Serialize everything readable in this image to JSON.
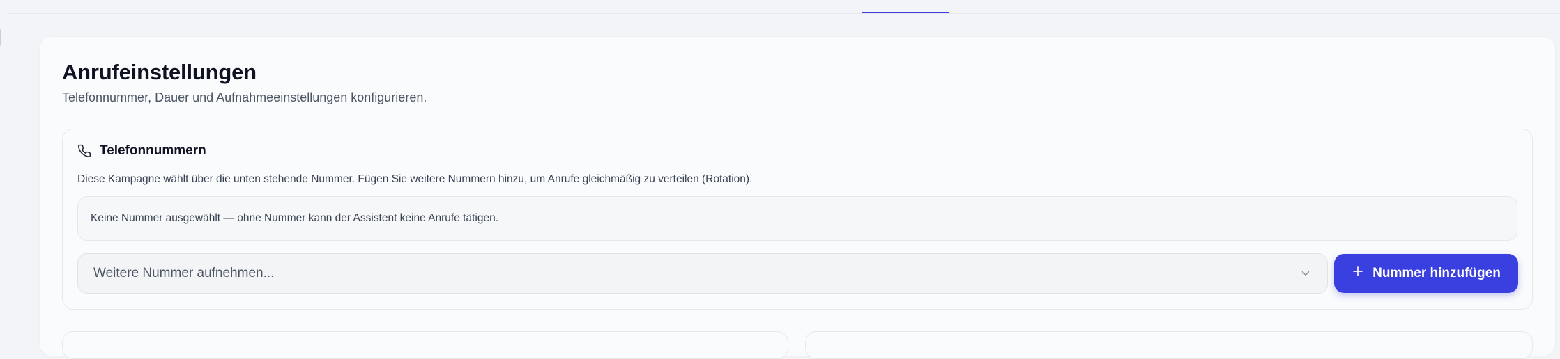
{
  "page": {
    "title": "Anrufeinstellungen",
    "subtitle": "Telefonnummer, Dauer und Aufnahmeeinstellungen konfigurieren."
  },
  "phone_section": {
    "title": "Telefonnummern",
    "icon": "phone-icon",
    "description": "Diese Kampagne wählt über die unten stehende Nummer. Fügen Sie weitere Nummern hinzu, um Anrufe gleichmäßig zu verteilen (Rotation).",
    "notice": "Keine Nummer ausgewählt — ohne Nummer kann der Assistent keine Anrufe tätigen.",
    "select": {
      "placeholder": "Weitere Nummer aufnehmen...",
      "icon": "chevron-down-icon"
    },
    "add_button": {
      "label": "Nummer hinzufügen",
      "icon": "plus-icon"
    }
  },
  "colors": {
    "accent": "#3a3fe0",
    "background": "#f3f4f7",
    "card": "#fafbfc",
    "text": "#0f1222"
  }
}
